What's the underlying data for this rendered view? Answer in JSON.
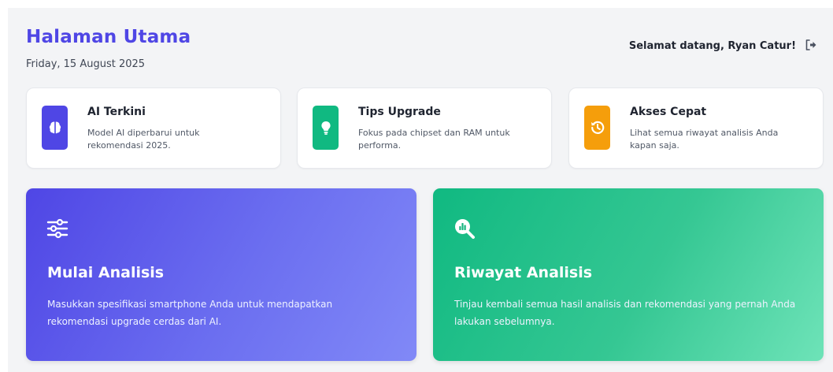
{
  "header": {
    "title": "Halaman Utama",
    "date": "Friday, 15 August 2025",
    "welcome_prefix": "Selamat datang,",
    "user_name": "Ryan Catur!"
  },
  "info_cards": [
    {
      "title": "AI Terkini",
      "description": "Model AI diperbarui untuk rekomendasi 2025.",
      "icon": "brain-icon",
      "color": "#4f46e5"
    },
    {
      "title": "Tips Upgrade",
      "description": "Fokus pada chipset dan RAM untuk performa.",
      "icon": "lightbulb-icon",
      "color": "#10b981"
    },
    {
      "title": "Akses Cepat",
      "description": "Lihat semua riwayat analisis Anda kapan saja.",
      "icon": "history-icon",
      "color": "#f59e0b"
    }
  ],
  "actions": [
    {
      "title": "Mulai Analisis",
      "description": "Masukkan spesifikasi smartphone Anda untuk mendapatkan rekomendasi upgrade cerdas dari AI.",
      "icon": "sliders-icon"
    },
    {
      "title": "Riwayat Analisis",
      "description": "Tinjau kembali semua hasil analisis dan rekomendasi yang pernah Anda lakukan sebelumnya.",
      "icon": "magnifier-chart-icon"
    }
  ],
  "colors": {
    "primary": "#4f46e5",
    "success": "#10b981",
    "warning": "#f59e0b",
    "background": "#f3f4f6"
  }
}
